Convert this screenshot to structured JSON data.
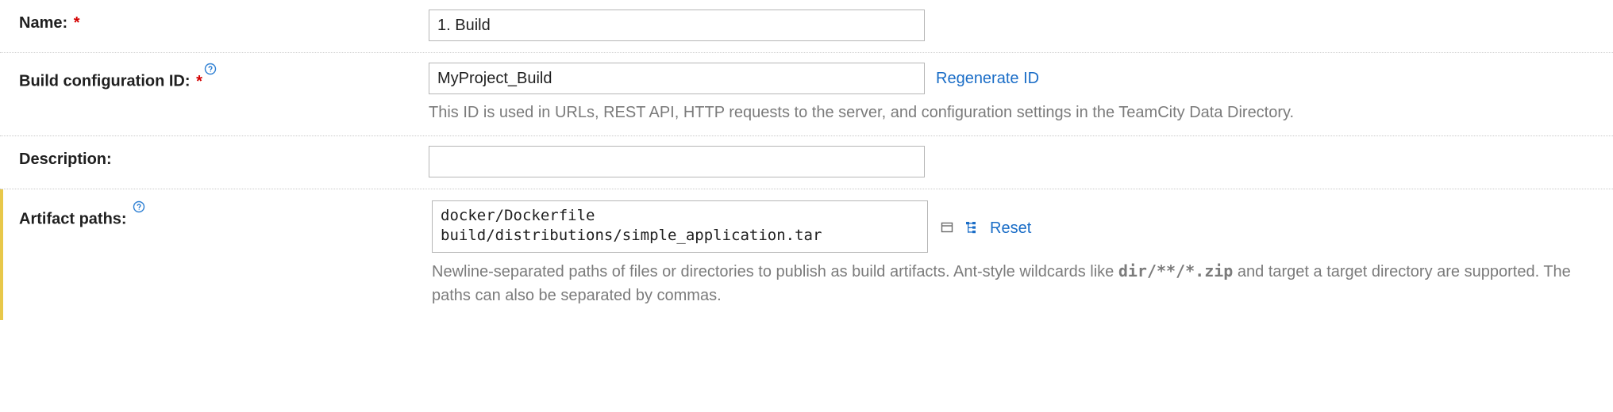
{
  "form": {
    "name": {
      "label": "Name:",
      "value": "1. Build"
    },
    "buildConfigId": {
      "label": "Build configuration ID:",
      "value": "MyProject_Build",
      "regenerateLabel": "Regenerate ID",
      "hint": "This ID is used in URLs, REST API, HTTP requests to the server, and configuration settings in the TeamCity Data Directory."
    },
    "description": {
      "label": "Description:",
      "value": ""
    },
    "artifactPaths": {
      "label": "Artifact paths:",
      "value": "docker/Dockerfile\nbuild/distributions/simple_application.tar",
      "resetLabel": "Reset",
      "hintPrefix": "Newline-separated paths of files or directories to publish as build artifacts. Ant-style wildcards like ",
      "hintCode": "dir/**/*.zip",
      "hintSuffix": " and target a target directory are supported. The paths can also be separated by commas."
    }
  }
}
